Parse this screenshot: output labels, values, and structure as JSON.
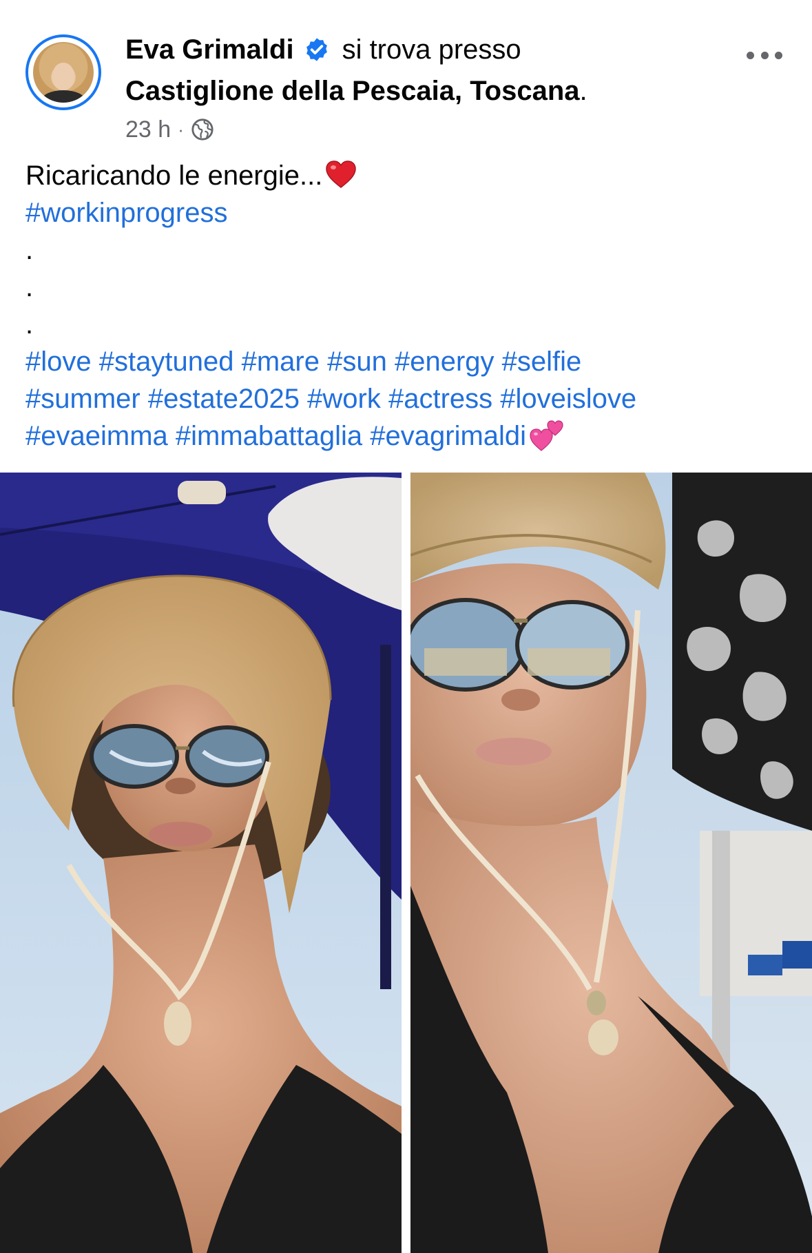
{
  "post": {
    "author": "Eva Grimaldi",
    "verified_icon": "verified-badge-icon",
    "at_text": "si trova presso",
    "location": "Castiglione della Pescaia, Toscana",
    "location_suffix": ".",
    "time": "23 h",
    "separator": "·",
    "audience_icon": "globe-icon",
    "more_icon": "more-options-icon"
  },
  "caption": {
    "line1_text": "Ricaricando le energie...",
    "line1_emoji": "red-heart-emoji",
    "line2_hashtag": "#workinprogress",
    "dot1": ".",
    "dot2": ".",
    "dot3": ".",
    "hashtags_row1": [
      "#love",
      "#staytuned",
      "#mare",
      "#sun",
      "#energy",
      "#selfie"
    ],
    "hashtags_row2": [
      "#summer",
      "#estate2025",
      "#work",
      "#actress",
      "#loveislove"
    ],
    "hashtags_row3": [
      "#evaeimma",
      "#immabattaglia",
      "#evagrimaldi"
    ],
    "row3_emoji": "two-hearts-emoji"
  },
  "photos": [
    {
      "name": "selfie-photo-1"
    },
    {
      "name": "selfie-photo-2"
    }
  ],
  "colors": {
    "accent_blue": "#1877f2",
    "hashtag_blue": "#216fdb",
    "text": "#050505",
    "secondary_text": "#65676b"
  }
}
